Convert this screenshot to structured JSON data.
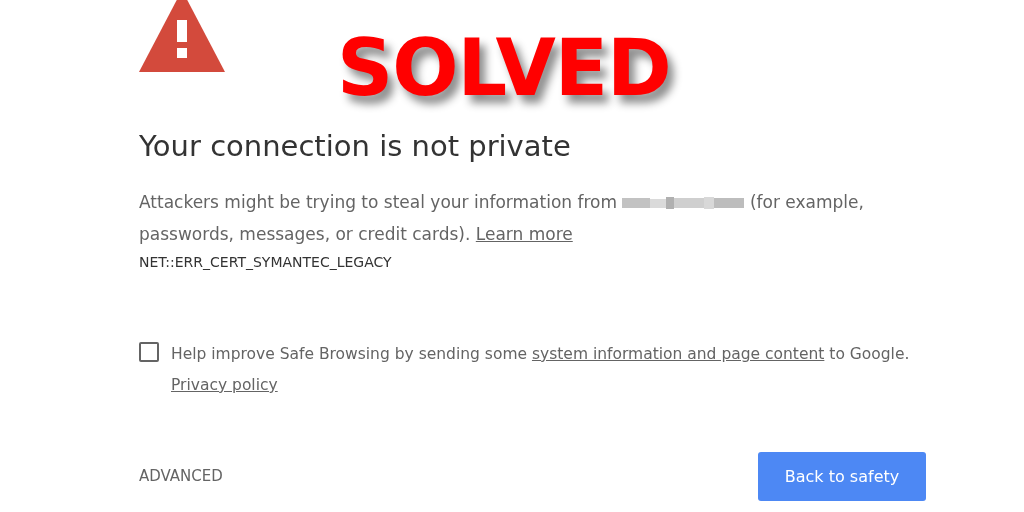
{
  "overlay_banner": "SOLVED",
  "heading": "Your connection is not private",
  "message": {
    "before": "Attackers might be trying to steal your information from",
    "after": "(for example, passwords, messages, or credit cards).",
    "link": "Learn more"
  },
  "error_code": "NET::ERR_CERT_SYMANTEC_LEGACY",
  "safe_browsing": {
    "checked": false,
    "before": "Help improve Safe Browsing by sending some",
    "link": "system information and page content",
    "after": "to Google.",
    "privacy_link": "Privacy policy"
  },
  "advanced": "ADVANCED",
  "primary_button": "Back to safety"
}
